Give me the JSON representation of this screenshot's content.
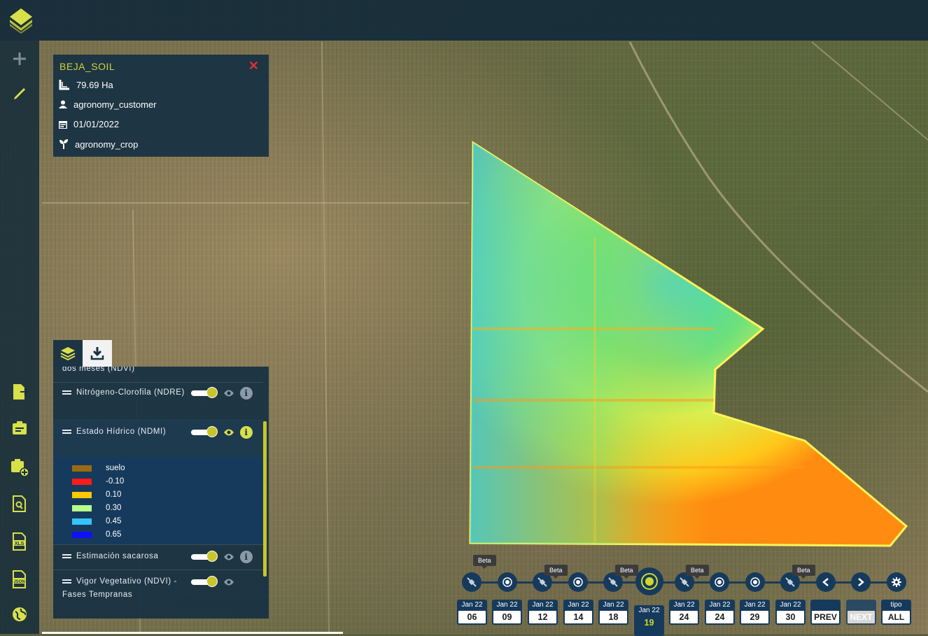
{
  "field": {
    "name": "BEJA_SOIL",
    "area": "79.69 Ha",
    "user": "agronomy_customer",
    "date": "01/01/2022",
    "crop": "agronomy_crop"
  },
  "layers": {
    "partial_top": "dos meses (NDVI)",
    "items": [
      {
        "label": "Nitrógeno-Clorofila (NDRE)"
      },
      {
        "label": "Estado Hídrico (NDMI)"
      },
      {
        "label": "Estimación sacarosa"
      },
      {
        "label": "Vigor Vegetativo (NDVI) - Fases Tempranas"
      }
    ],
    "legend": [
      {
        "label": "suelo",
        "color": "#9a6a12"
      },
      {
        "label": "-0.10",
        "color": "#ff1a1a"
      },
      {
        "label": "0.10",
        "color": "#ffc800"
      },
      {
        "label": "0.30",
        "color": "#b7ff8a"
      },
      {
        "label": "0.45",
        "color": "#36c4ff"
      },
      {
        "label": "0.65",
        "color": "#1010ff"
      }
    ]
  },
  "timeline": {
    "beta_label": "Beta",
    "dates": [
      {
        "month": "Jan 22",
        "day": "06"
      },
      {
        "month": "Jan 22",
        "day": "09"
      },
      {
        "month": "Jan 22",
        "day": "12"
      },
      {
        "month": "Jan 22",
        "day": "14"
      },
      {
        "month": "Jan 22",
        "day": "18"
      },
      {
        "month": "Jan 22",
        "day": "19"
      },
      {
        "month": "Jan 22",
        "day": "24"
      },
      {
        "month": "Jan 22",
        "day": "24"
      },
      {
        "month": "Jan 22",
        "day": "29"
      },
      {
        "month": "Jan 22",
        "day": "30"
      }
    ],
    "prev_label": "PREV",
    "next_label": "NEXT",
    "type_label": "tipo",
    "type_value": "ALL"
  },
  "colors": {
    "accent": "#cdd43a",
    "panel": "#163042",
    "close": "#e03030"
  }
}
